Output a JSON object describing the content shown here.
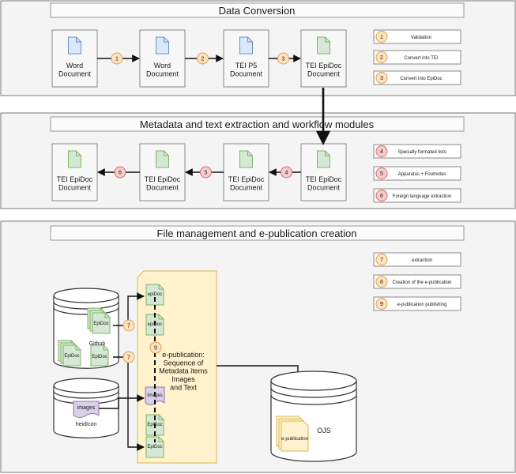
{
  "sections": {
    "data_conversion": {
      "title": "Data Conversion",
      "docs": [
        "Word\nDocument",
        "Word\nDocument",
        "TEI P5\nDocument",
        "TEI EpiDoc\nDocument"
      ],
      "steps": [
        "1",
        "2",
        "3"
      ],
      "legend": [
        {
          "num": "1",
          "label": "Validation"
        },
        {
          "num": "2",
          "label": "Convert into TEI"
        },
        {
          "num": "3",
          "label": "Convert into EpiDoc"
        }
      ]
    },
    "metadata": {
      "title": "Metadata  and text extraction  and workflow modules",
      "docs": [
        "TEI EpiDoc\nDocument",
        "TEI EpiDoc\nDocument",
        "TEI EpiDoc\nDocument",
        "TEI EpiDoc\nDocument"
      ],
      "steps": [
        "4",
        "5",
        "6"
      ],
      "legend": [
        {
          "num": "4",
          "label": "Specially formated lists"
        },
        {
          "num": "5",
          "label": "Apparatus + Footnotes"
        },
        {
          "num": "6",
          "label": "Foreign language extraction"
        }
      ]
    },
    "file_management": {
      "title": "File management and e-publication creation",
      "legend": [
        {
          "num": "7",
          "label": "extraction"
        },
        {
          "num": "8",
          "label": "Creation of the e-publication"
        },
        {
          "num": "9",
          "label": "e-publication publishing"
        }
      ],
      "github": {
        "label": "Github",
        "file1": "EpiDoc",
        "file2": "EpiDoc",
        "file3": "EpiDoc"
      },
      "heidicon": {
        "label": "heidIcon",
        "file": "images"
      },
      "publication": {
        "items": [
          "epiDoc",
          "epiDoc",
          "images",
          "EpiDoc",
          "EpiDoc"
        ],
        "step": "9",
        "description": "e-publication:\nSequence of\nMetadata items\nImages\nand Text"
      },
      "ojs": {
        "label": "OJS",
        "file": "e-publication"
      },
      "extract_steps": [
        "7",
        "7"
      ]
    }
  },
  "colors": {
    "orange_fill": "#fde2bf",
    "orange_stroke": "#e0a050",
    "red_fill": "#f6cccc",
    "red_stroke": "#d96a6a",
    "blue_doc": "#dae8fc",
    "blue_doc_stroke": "#6c8ebf",
    "green_doc": "#d5e8d4",
    "green_doc_stroke": "#82b366",
    "yellow_pub": "#fff2cc",
    "yellow_pub_stroke": "#d6b656",
    "purple_doc": "#d6d0e8",
    "purple_doc_stroke": "#9673a6"
  }
}
